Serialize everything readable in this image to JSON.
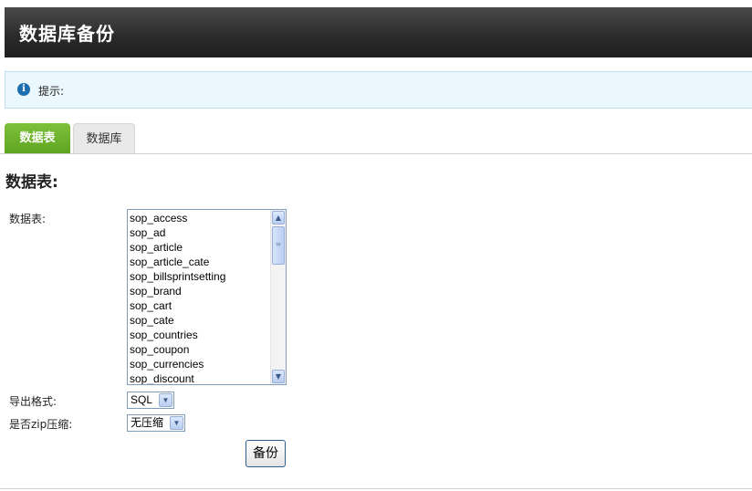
{
  "header": {
    "title": "数据库备份"
  },
  "notice": {
    "icon": "info-icon",
    "text": "提示:"
  },
  "tabs": [
    {
      "label": "数据表",
      "active": true
    },
    {
      "label": "数据库",
      "active": false
    }
  ],
  "section": {
    "title": "数据表:"
  },
  "form": {
    "tables_label": "数据表:",
    "tables": [
      "sop_access",
      "sop_ad",
      "sop_article",
      "sop_article_cate",
      "sop_billsprintsetting",
      "sop_brand",
      "sop_cart",
      "sop_cate",
      "sop_countries",
      "sop_coupon",
      "sop_currencies",
      "sop_discount"
    ],
    "format_label": "导出格式:",
    "format_value": "SQL",
    "zip_label": "是否zip压缩:",
    "zip_value": "无压缩",
    "submit_label": "备份"
  },
  "colors": {
    "active_tab": "#6cb22d",
    "header_bg": "#2f2f2f",
    "notice_bg": "#eaf7fc"
  }
}
